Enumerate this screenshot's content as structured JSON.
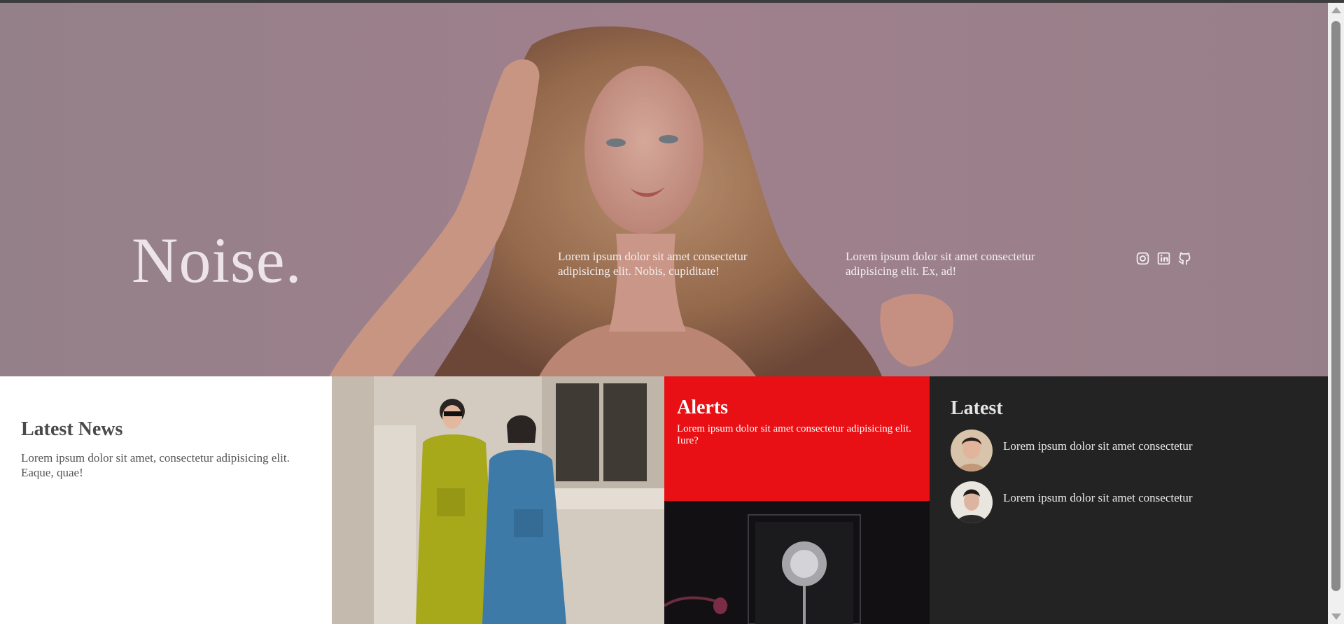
{
  "hero": {
    "brand": "Noise.",
    "text_a": "Lorem ipsum dolor sit amet consectetur adipisicing elit. Nobis, cupiditate!",
    "text_b": "Lorem ipsum dolor sit amet consectetur adipisicing elit. Ex, ad!",
    "social_icons": [
      "instagram-icon",
      "linkedin-icon",
      "github-icon"
    ]
  },
  "news": {
    "title": "Latest News",
    "body": "Lorem ipsum dolor sit amet, consectetur adipisicing elit. Eaque, quae!"
  },
  "alerts": {
    "title": "Alerts",
    "body": "Lorem ipsum dolor sit amet consectetur adipisicing elit. Iure?"
  },
  "latest": {
    "title": "Latest",
    "items": [
      {
        "text": "Lorem ipsum dolor sit amet consectetur"
      },
      {
        "text": "Lorem ipsum dolor sit amet consectetur"
      }
    ]
  },
  "colors": {
    "alert_red": "#e81014",
    "dark_panel": "#232323",
    "hero_tint": "#9d8890"
  }
}
